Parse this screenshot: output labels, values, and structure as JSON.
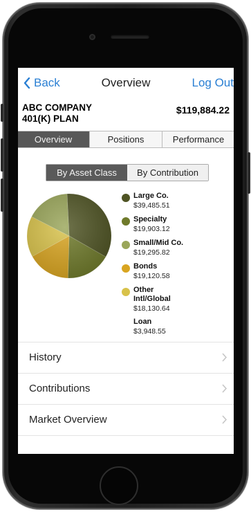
{
  "nav": {
    "back_label": "Back",
    "title": "Overview",
    "logout_label": "Log Out"
  },
  "plan": {
    "name": "ABC COMPANY\n401(K) PLAN",
    "total": "$119,884.22"
  },
  "tabs": [
    {
      "label": "Overview",
      "active": true
    },
    {
      "label": "Positions",
      "active": false
    },
    {
      "label": "Performance",
      "active": false
    }
  ],
  "segment": [
    {
      "label": "By Asset Class",
      "active": true
    },
    {
      "label": "By Contribution",
      "active": false
    }
  ],
  "allocation": [
    {
      "label": "Large Co.",
      "value_text": "$39,485.51",
      "value": 39485.51,
      "color": "#4f5424"
    },
    {
      "label": "Specialty",
      "value_text": "$19,903.12",
      "value": 19903.12,
      "color": "#6f7a2b"
    },
    {
      "label": "Small/Mid Co.",
      "value_text": "$19,295.82",
      "value": 19295.82,
      "color": "#9aa65a"
    },
    {
      "label": "Bonds",
      "value_text": "$19,120.58",
      "value": 19120.58,
      "color": "#d9a521"
    },
    {
      "label": "Other Intl/Global",
      "value_text": "$18,130.64",
      "value": 18130.64,
      "color": "#d8c24a"
    },
    {
      "label": "Loan",
      "value_text": "$3,948.55",
      "value": 3948.55,
      "color": null
    }
  ],
  "menu": [
    {
      "label": "History"
    },
    {
      "label": "Contributions"
    },
    {
      "label": "Market Overview"
    }
  ],
  "colors": {
    "link": "#2a7fd3",
    "active_tab": "#585858"
  }
}
